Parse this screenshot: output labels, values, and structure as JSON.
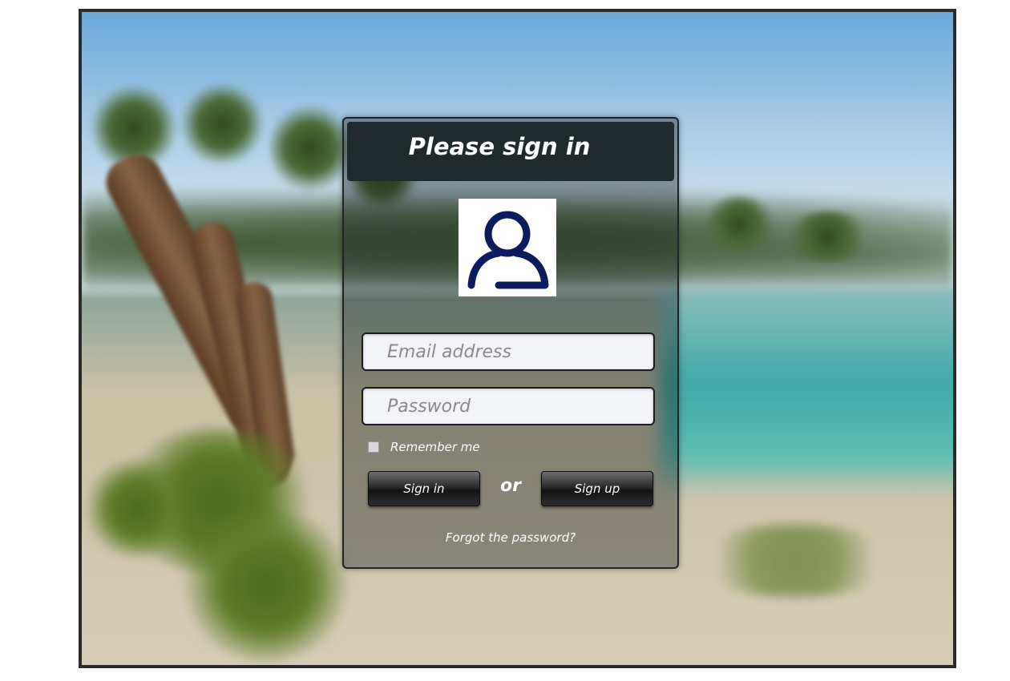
{
  "header": {
    "title": "Please sign in"
  },
  "avatar": {
    "icon": "user-outline-icon",
    "color": "#0b1b5e"
  },
  "form": {
    "email_placeholder": "Email address",
    "email_value": "",
    "password_placeholder": "Password",
    "password_value": "",
    "remember_label": "Remember me",
    "remember_checked": false
  },
  "actions": {
    "signin_label": "Sign in",
    "or_label": "or",
    "signup_label": "Sign up",
    "forgot_label": "Forgot the password?"
  },
  "colors": {
    "header_bg": "#1f2a2c",
    "button_dark": "#1a1a1a",
    "field_bg": "#f3f4f7"
  }
}
